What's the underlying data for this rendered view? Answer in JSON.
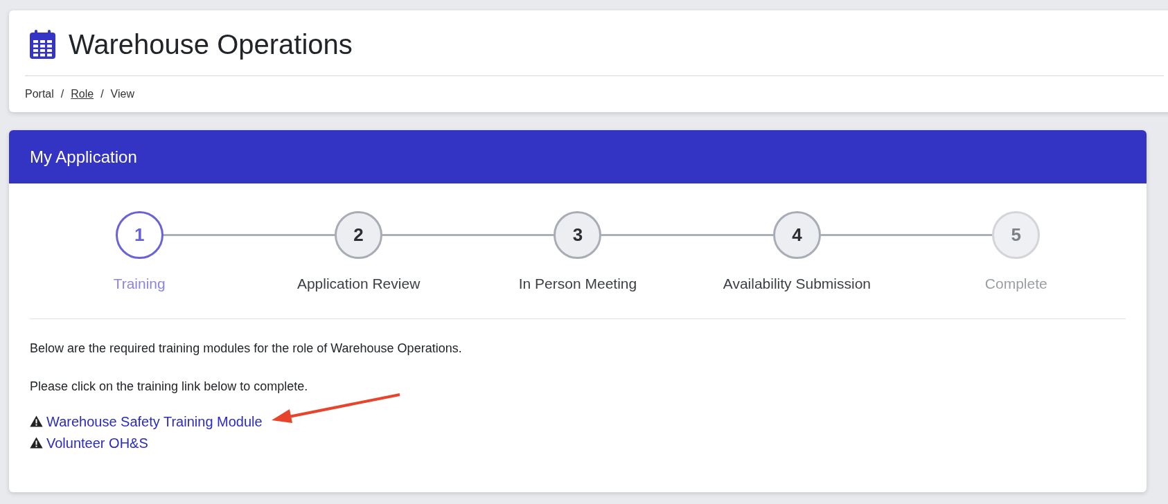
{
  "page": {
    "title": "Warehouse Operations"
  },
  "breadcrumb": [
    {
      "kind": "item",
      "label": "Portal"
    },
    {
      "kind": "separator",
      "label": "/"
    },
    {
      "kind": "link",
      "label": "Role"
    },
    {
      "kind": "separator",
      "label": "/"
    },
    {
      "kind": "item",
      "label": "View"
    }
  ],
  "card": {
    "title": "My Application"
  },
  "steps": [
    {
      "number": "1",
      "label": "Training",
      "selected": true,
      "disabled": false
    },
    {
      "number": "2",
      "label": "Application Review",
      "selected": false,
      "disabled": false
    },
    {
      "number": "3",
      "label": "In Person Meeting",
      "selected": false,
      "disabled": false
    },
    {
      "number": "4",
      "label": "Availability Submission",
      "selected": false,
      "disabled": false
    },
    {
      "number": "5",
      "label": "Complete",
      "selected": false,
      "disabled": true
    }
  ],
  "paragraphs": [
    "Below are the required training modules for the role of Warehouse Operations.",
    "Please click on the training link below to complete."
  ],
  "training_links": [
    {
      "label": "Warehouse Safety Training Module",
      "highlighted": true
    },
    {
      "label": "Volunteer OH&S",
      "highlighted": false
    }
  ]
}
